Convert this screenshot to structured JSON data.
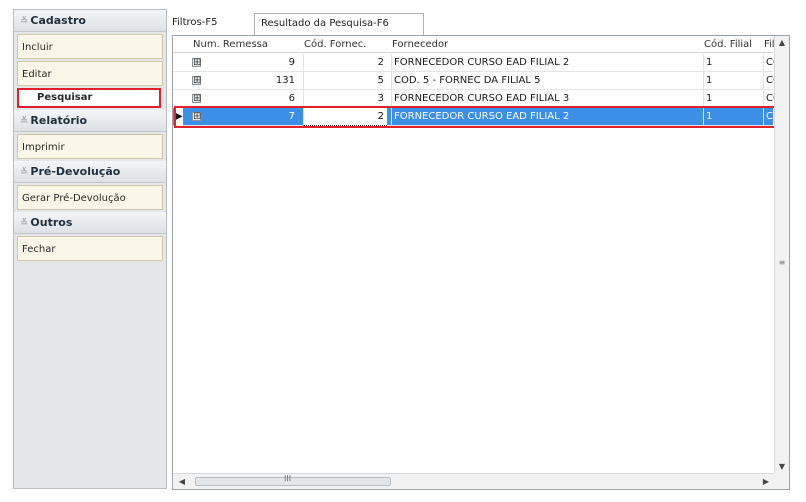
{
  "sidebar": {
    "sections": [
      {
        "title": "Cadastro",
        "items": [
          "Incluir",
          "Editar",
          "Pesquisar"
        ]
      },
      {
        "title": "Relatório",
        "items": [
          "Imprimir"
        ]
      },
      {
        "title": "Pré-Devolução",
        "items": [
          "Gerar Pré-Devolução"
        ]
      },
      {
        "title": "Outros",
        "items": [
          "Fechar"
        ]
      }
    ],
    "active_item": "Pesquisar"
  },
  "tabs": [
    {
      "label": "Filtros-F5",
      "active": false
    },
    {
      "label": "Resultado da Pesquisa-F6",
      "active": true
    }
  ],
  "grid": {
    "columns": [
      "Num. Remessa",
      "Cód. Fornec.",
      "Fornecedor",
      "Cód. Filial",
      "Fili"
    ],
    "rows": [
      {
        "remessa": "9",
        "cod": "2",
        "fornecedor": "FORNECEDOR CURSO EAD FILIAL 2",
        "filial": "1",
        "extra": "CO"
      },
      {
        "remessa": "131",
        "cod": "5",
        "fornecedor": "COD. 5 - FORNEC DA FILIAL 5",
        "filial": "1",
        "extra": "CO"
      },
      {
        "remessa": "6",
        "cod": "3",
        "fornecedor": "FORNECEDOR CURSO EAD FILIAL 3",
        "filial": "1",
        "extra": "CO"
      },
      {
        "remessa": "7",
        "cod": "2",
        "fornecedor": "FORNECEDOR CURSO EAD FILIAL 2",
        "filial": "1",
        "extra": "CO"
      }
    ],
    "selected_row": 3,
    "expand_glyph": "⊞",
    "row_indicator": "▶",
    "hscroll_grip": "III",
    "vscroll_grip": "≡"
  },
  "colors": {
    "selection": "#3b8fe6",
    "highlight": "#e0202a"
  }
}
